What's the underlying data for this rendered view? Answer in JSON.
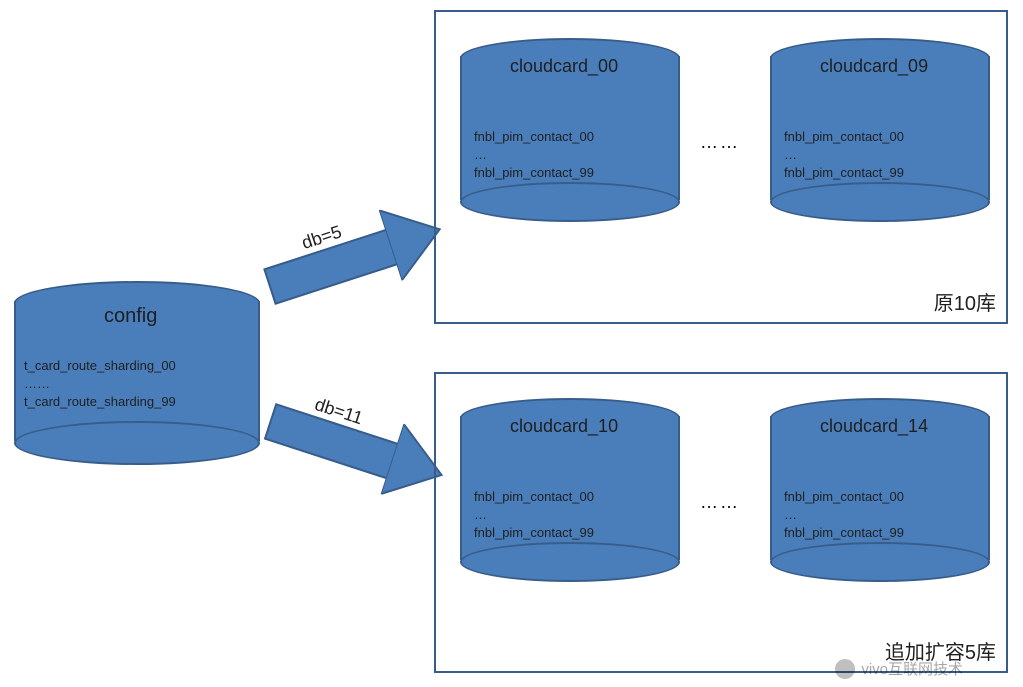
{
  "config_db": {
    "title": "config",
    "tables_first": "t_card_route_sharding_00",
    "ellipsis": "……",
    "tables_last": "t_card_route_sharding_99"
  },
  "arrows": {
    "top_label": "db=5",
    "bottom_label": "db=11"
  },
  "group_top": {
    "label": "原10库",
    "db_first": {
      "title": "cloudcard_00",
      "t1": "fnbl_pim_contact_00",
      "el": "…",
      "t2": "fnbl_pim_contact_99"
    },
    "db_last": {
      "title": "cloudcard_09",
      "t1": "fnbl_pim_contact_00",
      "el": "…",
      "t2": "fnbl_pim_contact_99"
    },
    "dots": "……"
  },
  "group_bottom": {
    "label": "追加扩容5库",
    "db_first": {
      "title": "cloudcard_10",
      "t1": "fnbl_pim_contact_00",
      "el": "…",
      "t2": "fnbl_pim_contact_99"
    },
    "db_last": {
      "title": "cloudcard_14",
      "t1": "fnbl_pim_contact_00",
      "el": "…",
      "t2": "fnbl_pim_contact_99"
    },
    "dots": "……"
  },
  "watermark": "vivo互联网技术"
}
